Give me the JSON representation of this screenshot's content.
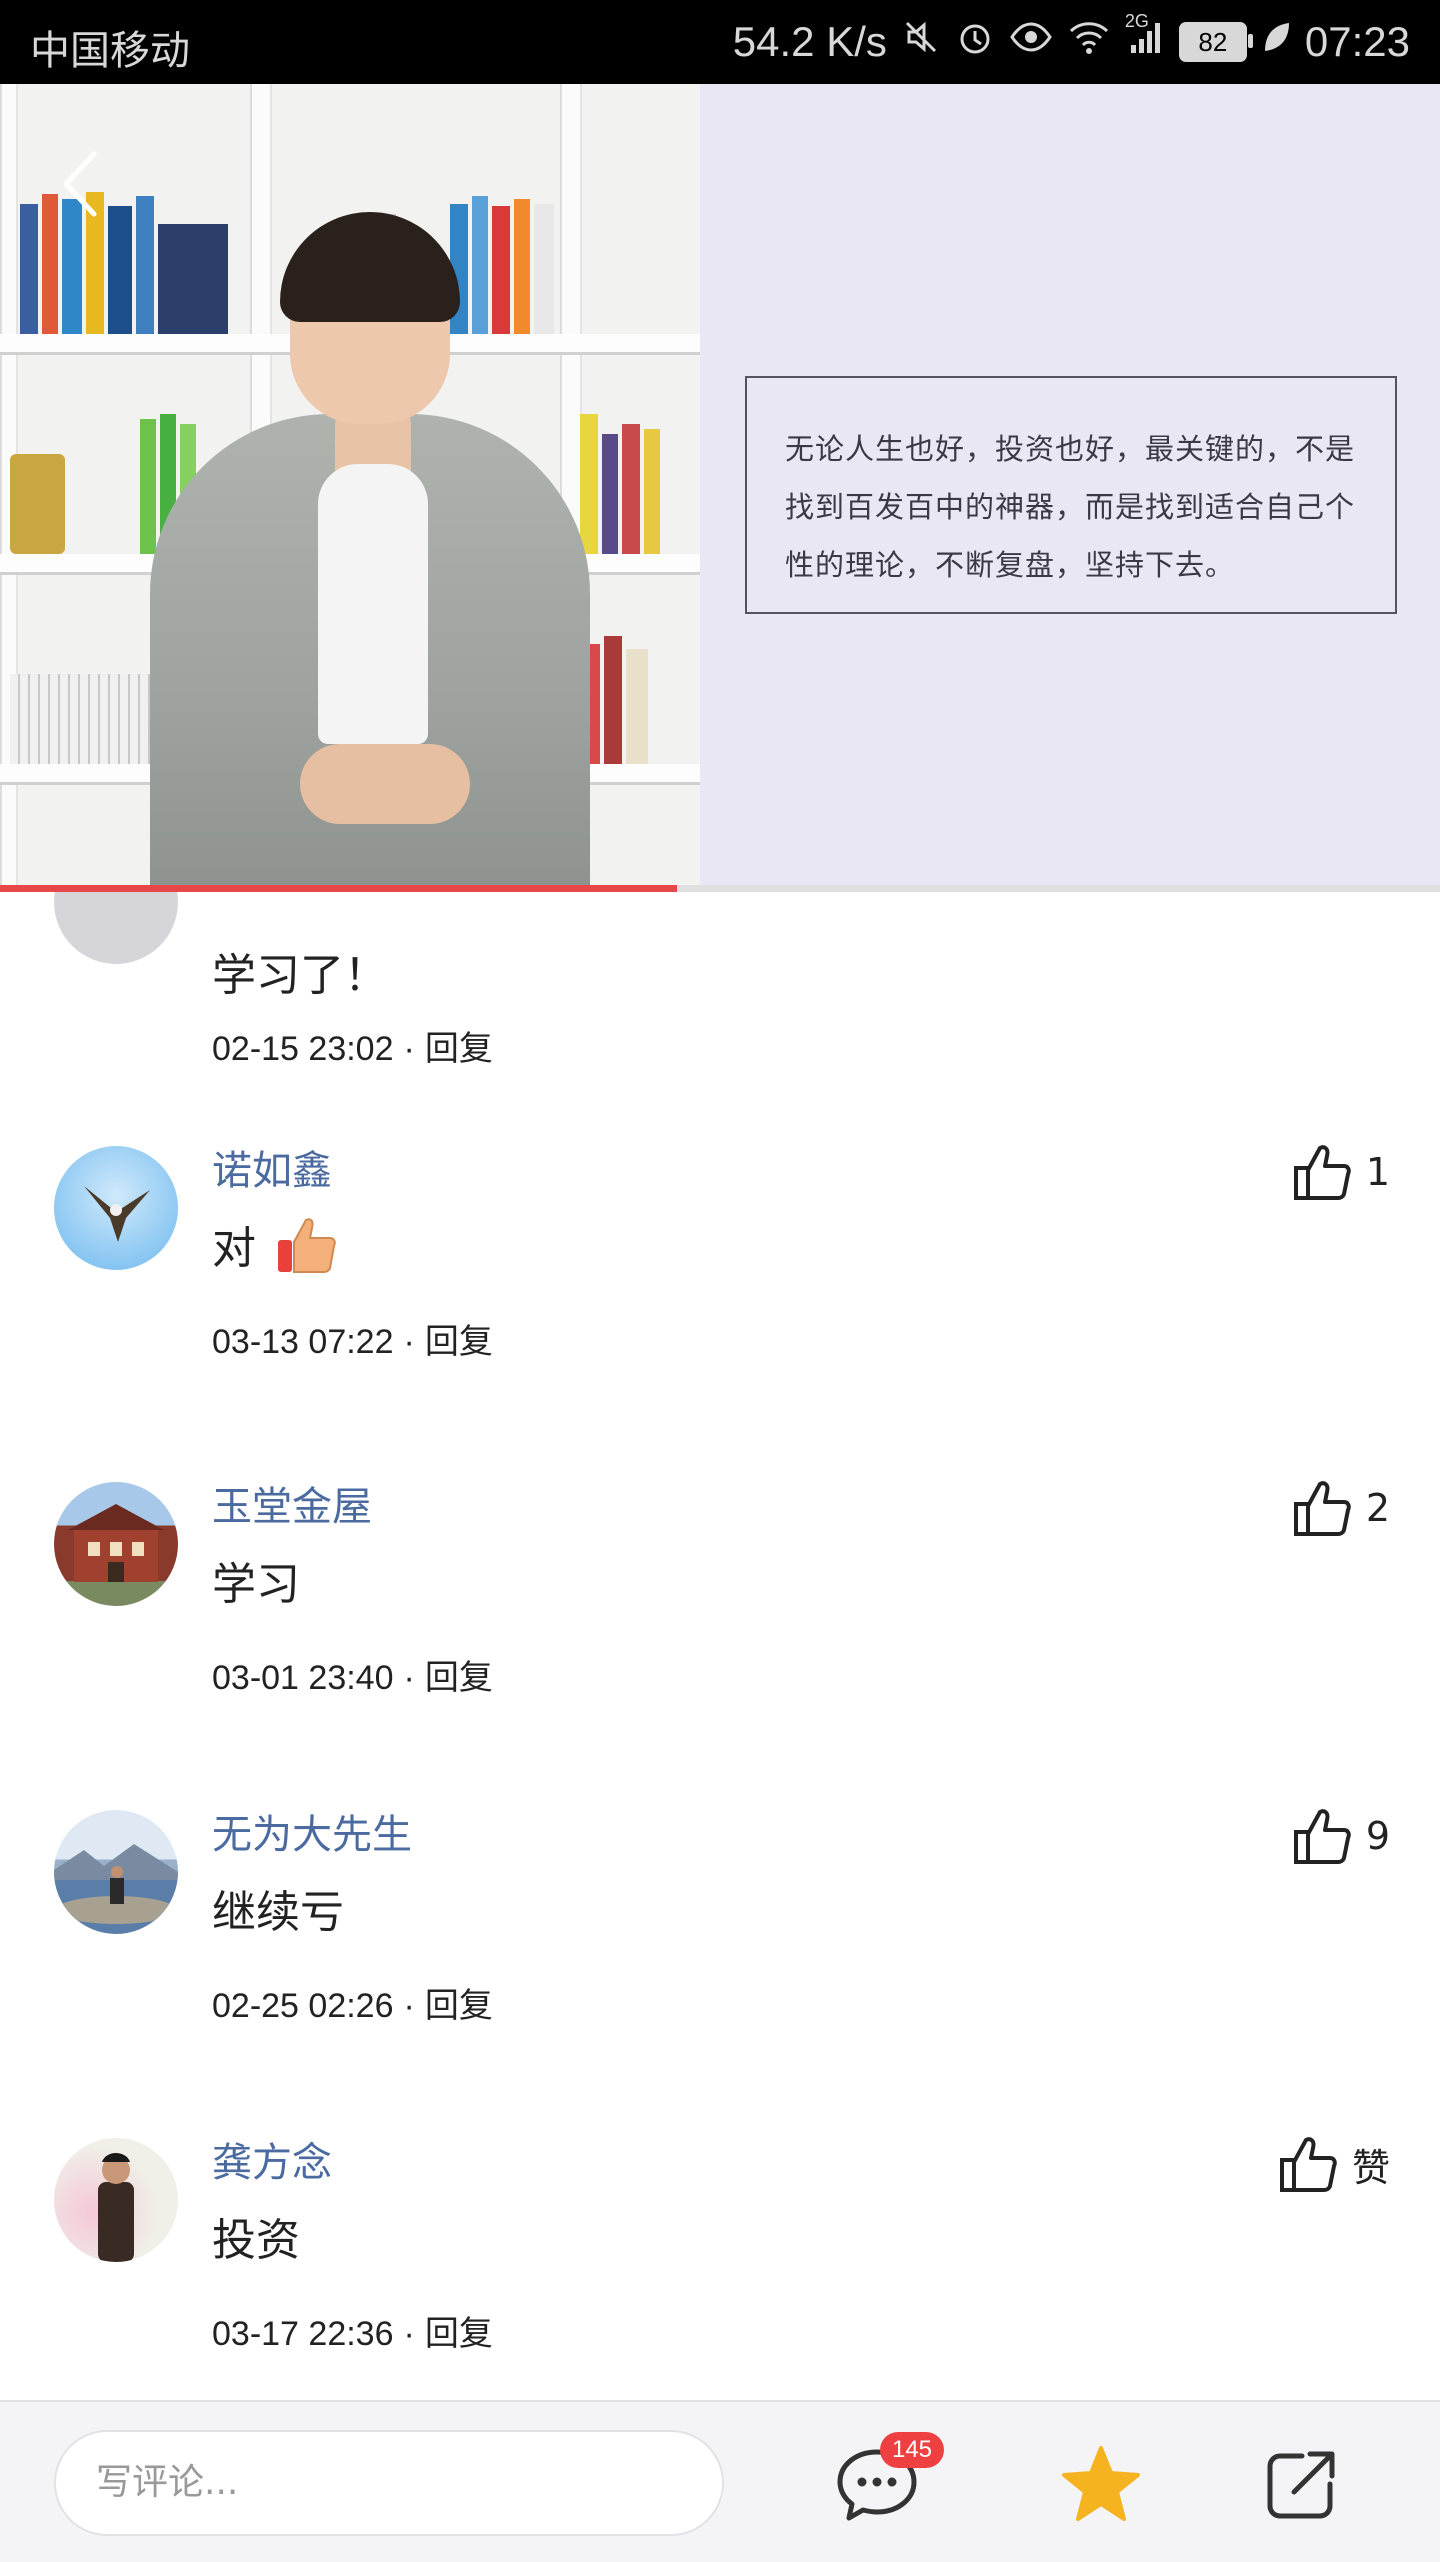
{
  "status_bar": {
    "carrier": "中国移动",
    "speed": "54.2 K/s",
    "network": "2G",
    "battery": "82",
    "time": "07:23"
  },
  "video": {
    "quote": "无论人生也好，投资也好，最关键的，不是找到百发百中的神器，而是找到适合自己个性的理论，不断复盘，坚持下去。",
    "progress": 0.47
  },
  "comments": [
    {
      "name": "",
      "text": "学习了！",
      "time": "02-15 23:02",
      "reply": "回复",
      "likes": "",
      "avatar": "grey-avatar"
    },
    {
      "name": "诺如鑫",
      "text": "对",
      "emoji": "thumbs-up-emoji",
      "time": "03-13 07:22",
      "reply": "回复",
      "likes": "1",
      "avatar": "eagle-avatar"
    },
    {
      "name": "玉堂金屋",
      "text": "学习",
      "time": "03-01 23:40",
      "reply": "回复",
      "likes": "2",
      "avatar": "building-avatar"
    },
    {
      "name": "无为大先生",
      "text": "继续亏",
      "time": "02-25 02:26",
      "reply": "回复",
      "likes": "9",
      "avatar": "lake-avatar"
    },
    {
      "name": "龚方念",
      "text": "投资",
      "time": "03-17 22:36",
      "reply": "回复",
      "likes": "赞",
      "avatar": "person-avatar"
    }
  ],
  "bottom_bar": {
    "input_placeholder": "写评论...",
    "comment_count": "145"
  },
  "colors": {
    "accent": "#e8474a",
    "username": "#4a6aa0",
    "star": "#f5b31f"
  }
}
